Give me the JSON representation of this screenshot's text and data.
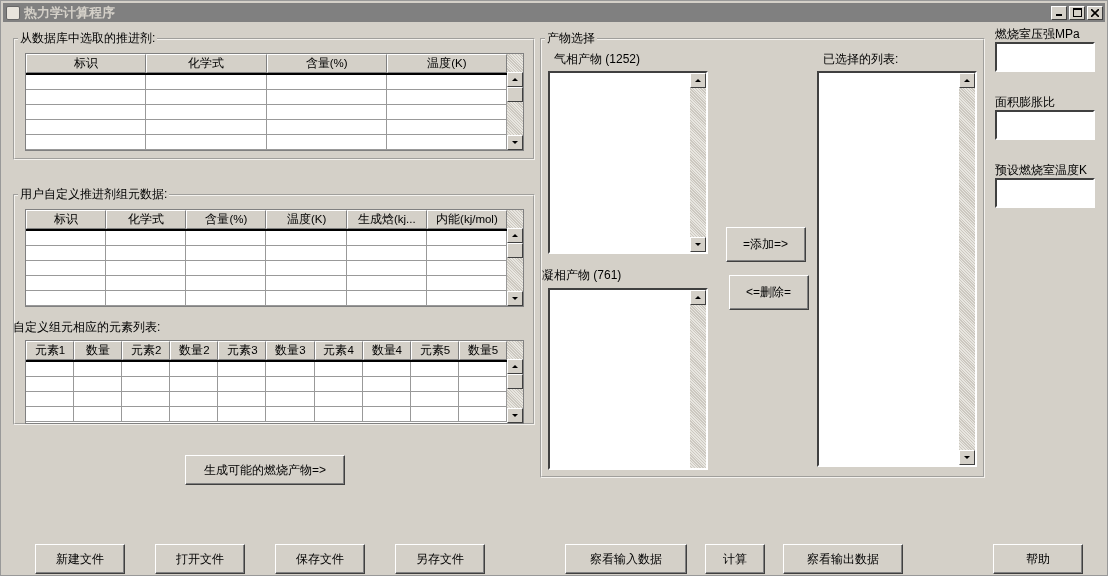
{
  "window": {
    "title": "热力学计算程序"
  },
  "database_propellants": {
    "title": "从数据库中选取的推进剂:",
    "columns": [
      "标识",
      "化学式",
      "含量(%)",
      "温度(K)"
    ]
  },
  "custom_components": {
    "title": "用户自定义推进剂组元数据:",
    "columns": [
      "标识",
      "化学式",
      "含量(%)",
      "温度(K)",
      "生成焓(kj...",
      "内能(kj/mol)"
    ]
  },
  "element_list": {
    "title": "自定义组元相应的元素列表:",
    "columns": [
      "元素1",
      "数量",
      "元素2",
      "数量2",
      "元素3",
      "数量3",
      "元素4",
      "数量4",
      "元素5",
      "数量5"
    ]
  },
  "generate_button": "生成可能的燃烧产物=>",
  "product_selection": {
    "title": "产物选择",
    "gas_products": "气相产物 (1252)",
    "condensed_products": "凝相产物 (761)",
    "selected_list": "已选择的列表:",
    "add_button": "=添加=>",
    "remove_button": "<=删除="
  },
  "parameters": [
    {
      "label": "燃烧室压强MPa"
    },
    {
      "label": "面积膨胀比"
    },
    {
      "label": "预设燃烧室温度K"
    }
  ],
  "file_buttons": [
    "新建文件",
    "打开文件",
    "保存文件",
    "另存文件"
  ],
  "action_buttons": [
    "察看输入数据",
    "计算",
    "察看输出数据"
  ],
  "help_button": "帮助"
}
